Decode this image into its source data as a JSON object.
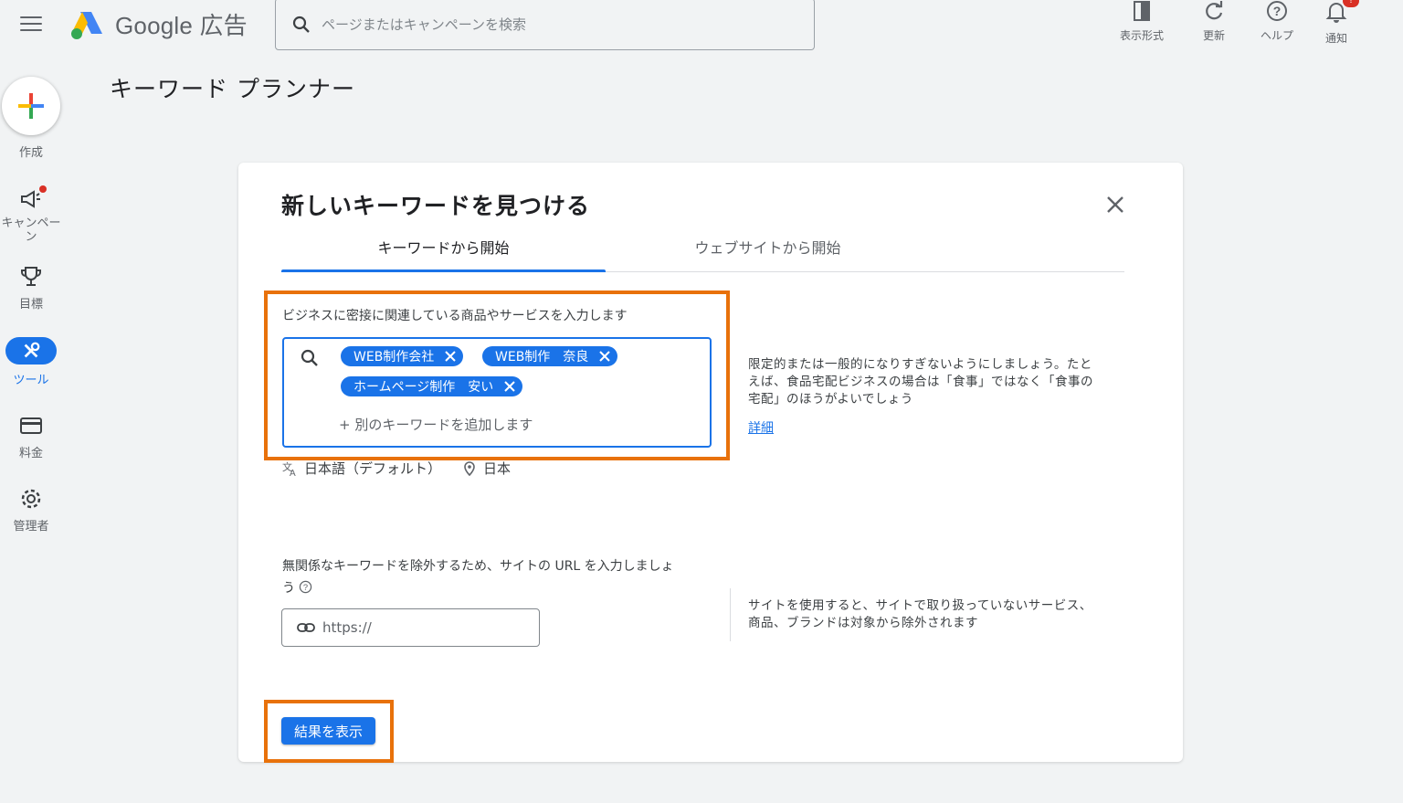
{
  "app": {
    "logo_text": "Google 広告",
    "search_placeholder": "ページまたはキャンペーンを検索"
  },
  "top_actions": [
    {
      "label": "表示形式",
      "icon": "layout-icon"
    },
    {
      "label": "更新",
      "icon": "refresh-icon"
    },
    {
      "label": "ヘルプ",
      "icon": "help-icon"
    },
    {
      "label": "通知",
      "icon": "bell-icon",
      "badge": "!"
    }
  ],
  "page_title": "キーワード プランナー",
  "rail": {
    "create": "作成",
    "campaign": "キャンペーン",
    "goals": "目標",
    "tools": "ツール",
    "billing": "料金",
    "admin": "管理者"
  },
  "dialog": {
    "title": "新しいキーワードを見つける",
    "tabs": [
      {
        "label": "キーワードから開始",
        "active": true
      },
      {
        "label": "ウェブサイトから開始",
        "active": false
      }
    ],
    "keyword_label": "ビジネスに密接に関連している商品やサービスを入力します",
    "chips": [
      "WEB制作会社",
      "WEB制作　奈良",
      "ホームページ制作　安い"
    ],
    "add_keyword": "+ 別のキーワードを追加します",
    "language": "日本語（デフォルト）",
    "location": "日本",
    "hint_keywords_1": "限定的または一般的になりすぎないようにしましょう。たと",
    "hint_keywords_2": "えば、食品宅配ビジネスの場合は「食事」ではなく「食事の",
    "hint_keywords_3": "宅配」のほうがよいでしょう",
    "details_link": "詳細",
    "url_label_1": "無関係なキーワードを除外するため、サイトの URL を入力しましょ",
    "url_label_2": "う",
    "url_placeholder": "https://",
    "hint_url_1": "サイトを使用すると、サイトで取り扱っていないサービス、",
    "hint_url_2": "商品、ブランドは対象から除外されます",
    "results_button": "結果を表示"
  },
  "colors": {
    "primary": "#1a73e8",
    "highlight": "#e8710a",
    "alert": "#d93025"
  }
}
